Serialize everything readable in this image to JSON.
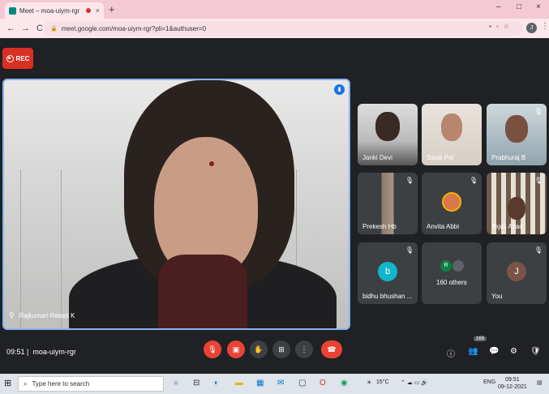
{
  "browser": {
    "tab_title": "Meet – moa-uiym-rgr",
    "tab_close": "×",
    "new_tab": "+",
    "window_controls": [
      "–",
      "□",
      "×"
    ],
    "nav": [
      "←",
      "→",
      "C"
    ],
    "url": "meet.google.com/moa-uiym-rgr?pli=1&authuser=0",
    "profile_initial": "J",
    "menu": "⋮"
  },
  "recording": {
    "label": "REC"
  },
  "main_speaker": {
    "name": "Rajkumari Rebati K",
    "speaking_icon": "audio-wave-icon"
  },
  "participants": [
    {
      "name": "Janki Devi",
      "type": "video",
      "muted": false
    },
    {
      "name": "Swati Pal",
      "type": "video",
      "muted": false
    },
    {
      "name": "Prabhuraj B",
      "type": "video",
      "muted": true
    },
    {
      "name": "Prekesh Hb",
      "type": "video",
      "muted": true
    },
    {
      "name": "Anvita Abbi",
      "type": "photo",
      "muted": true
    },
    {
      "name": "Tejas Azad",
      "type": "video",
      "muted": true
    },
    {
      "name": "bidhu bhushan ...",
      "type": "avatar",
      "initial": "b",
      "color": "#12b5cb",
      "muted": true
    },
    {
      "name": "160 others",
      "type": "group",
      "initial": "R",
      "muted": false
    },
    {
      "name": "You",
      "type": "avatar",
      "initial": "J",
      "color": "#795548",
      "muted": true
    }
  ],
  "meeting": {
    "time": "09:51",
    "code": "moa-uiym-rgr",
    "people_count": "169"
  },
  "controls": {
    "mic": "mic-off-icon",
    "camera": "camera-off-icon",
    "raise_hand": "hand-icon",
    "present": "present-icon",
    "more": "more-vert-icon",
    "end_call": "end-call-icon"
  },
  "taskbar": {
    "search_placeholder": "Type here to search",
    "weather": "15°C",
    "language": "ENG",
    "clock_time": "09:51",
    "clock_date": "09-12-2021"
  },
  "colors": {
    "meet_bg": "#202124",
    "tile_bg": "#3c4043",
    "accent_red": "#ea4335",
    "active_border": "#8ab4f8"
  }
}
